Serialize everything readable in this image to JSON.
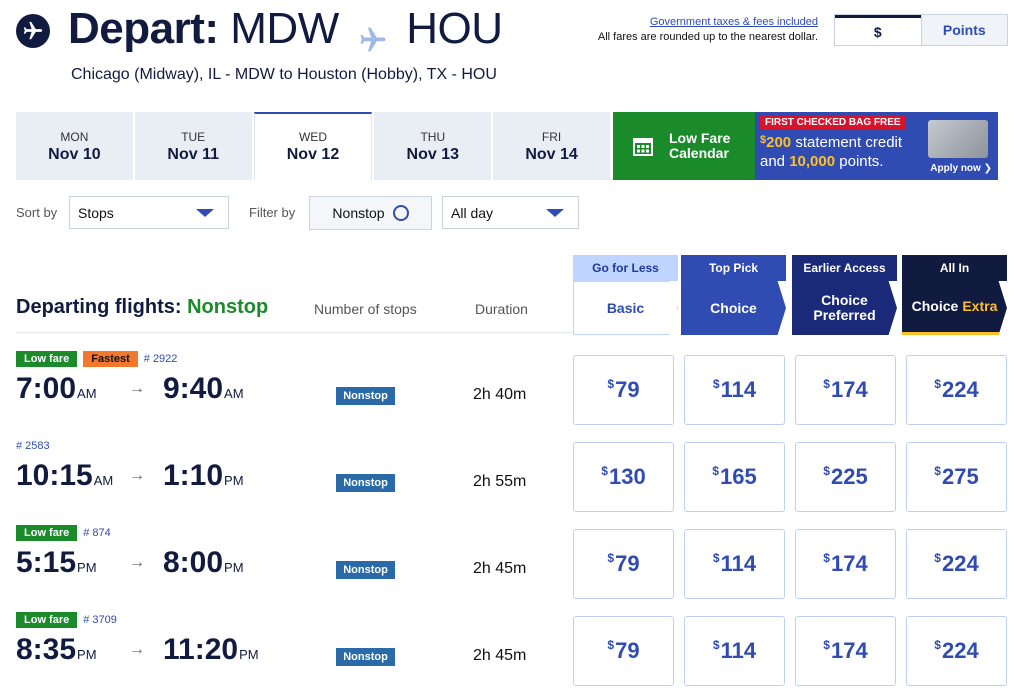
{
  "header": {
    "title_prefix": "Depart:",
    "origin": "MDW",
    "destination": "HOU",
    "subtitle": "Chicago (Midway), IL - MDW to Houston (Hobby), TX - HOU",
    "taxes_link": "Government taxes & fees included",
    "rounding_note": "All fares are rounded up to the nearest dollar.",
    "currency_options": [
      "$",
      "Points"
    ],
    "selected_currency": "$"
  },
  "date_tabs": [
    {
      "dow": "MON",
      "date": "Nov 10"
    },
    {
      "dow": "TUE",
      "date": "Nov 11"
    },
    {
      "dow": "WED",
      "date": "Nov 12"
    },
    {
      "dow": "THU",
      "date": "Nov 13"
    },
    {
      "dow": "FRI",
      "date": "Nov 14"
    }
  ],
  "active_date": "Nov 12",
  "low_fare_calendar": {
    "line1": "Low Fare",
    "line2": "Calendar"
  },
  "promo": {
    "badge": "FIRST CHECKED BAG FREE",
    "amount": "200",
    "amount_suffix": " statement credit",
    "and_word": "and ",
    "points": "10,000",
    "points_suffix": " points.",
    "cta": "Apply now"
  },
  "filters": {
    "sort_label": "Sort by",
    "sort_value": "Stops",
    "filter_label": "Filter by",
    "nonstop_label": "Nonstop",
    "time_value": "All day"
  },
  "fare_classes": [
    {
      "tag": "Go for Less",
      "name": "Basic"
    },
    {
      "tag": "Top Pick",
      "name": "Choice"
    },
    {
      "tag": "Earlier Access",
      "name_line1": "Choice",
      "name_line2": "Preferred"
    },
    {
      "tag": "All In",
      "name": "Choice",
      "name_extra": "Extra"
    }
  ],
  "list_header": {
    "title": "Departing flights:",
    "title_filter": "Nonstop",
    "col_stops": "Number of stops",
    "col_duration": "Duration"
  },
  "flights": [
    {
      "badges": [
        "Low fare",
        "Fastest"
      ],
      "flight": "# 2922",
      "dep_time": "7:00",
      "dep_ampm": "AM",
      "arr_time": "9:40",
      "arr_ampm": "AM",
      "stops": "Nonstop",
      "duration": "2h 40m",
      "prices": [
        "79",
        "114",
        "174",
        "224"
      ]
    },
    {
      "badges": [],
      "flight": "# 2583",
      "dep_time": "10:15",
      "dep_ampm": "AM",
      "arr_time": "1:10",
      "arr_ampm": "PM",
      "stops": "Nonstop",
      "duration": "2h 55m",
      "prices": [
        "130",
        "165",
        "225",
        "275"
      ]
    },
    {
      "badges": [
        "Low fare"
      ],
      "flight": "# 874",
      "dep_time": "5:15",
      "dep_ampm": "PM",
      "arr_time": "8:00",
      "arr_ampm": "PM",
      "stops": "Nonstop",
      "duration": "2h 45m",
      "prices": [
        "79",
        "114",
        "174",
        "224"
      ]
    },
    {
      "badges": [
        "Low fare"
      ],
      "flight": "# 3709",
      "dep_time": "8:35",
      "dep_ampm": "PM",
      "arr_time": "11:20",
      "arr_ampm": "PM",
      "stops": "Nonstop",
      "duration": "2h 45m",
      "prices": [
        "79",
        "114",
        "174",
        "224"
      ]
    }
  ],
  "price_currency_symbol": "$",
  "colors": {
    "navy": "#111b40",
    "blue": "#304cb2",
    "green": "#1b8a2b",
    "orange": "#f4772b",
    "gold": "#ffbf27",
    "red": "#d5152e"
  }
}
